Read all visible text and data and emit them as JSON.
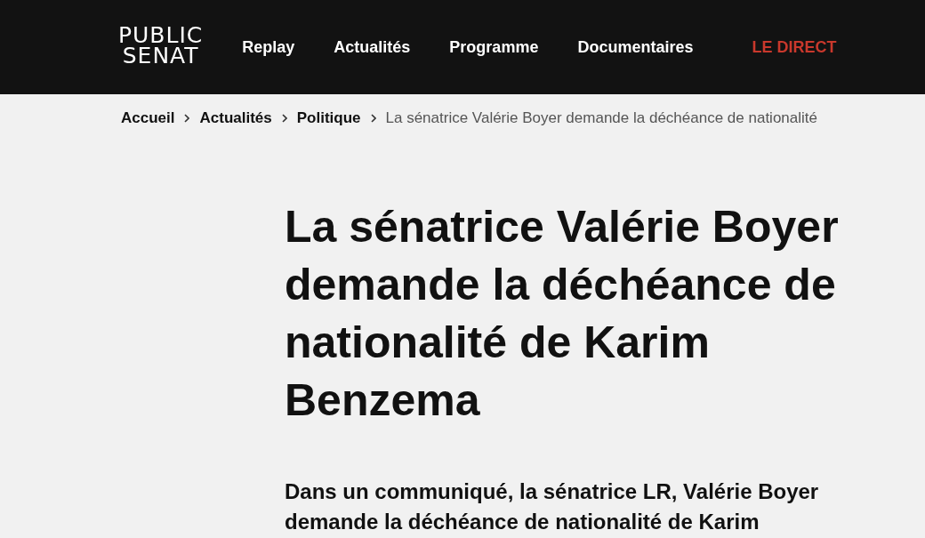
{
  "header": {
    "logo": "PUBLIC SENAT",
    "nav": [
      {
        "label": "Replay",
        "kind": "link"
      },
      {
        "label": "Actualités",
        "kind": "link"
      },
      {
        "label": "Programme",
        "kind": "link"
      },
      {
        "label": "Documentaires",
        "kind": "link"
      },
      {
        "label": "LE DIRECT",
        "kind": "live"
      }
    ]
  },
  "breadcrumb": [
    {
      "label": "Accueil",
      "kind": "link"
    },
    {
      "label": "Actualités",
      "kind": "link"
    },
    {
      "label": "Politique",
      "kind": "link"
    },
    {
      "label": "La sénatrice Valérie Boyer demande la déchéance de nationalité",
      "kind": "current"
    }
  ],
  "article": {
    "title": "La sénatrice Valérie Boyer demande la déchéance de nationalité de Karim Benzema",
    "lead": "Dans un communiqué, la sénatrice LR, Valérie Boyer demande la déchéance de nationalité de Karim"
  }
}
